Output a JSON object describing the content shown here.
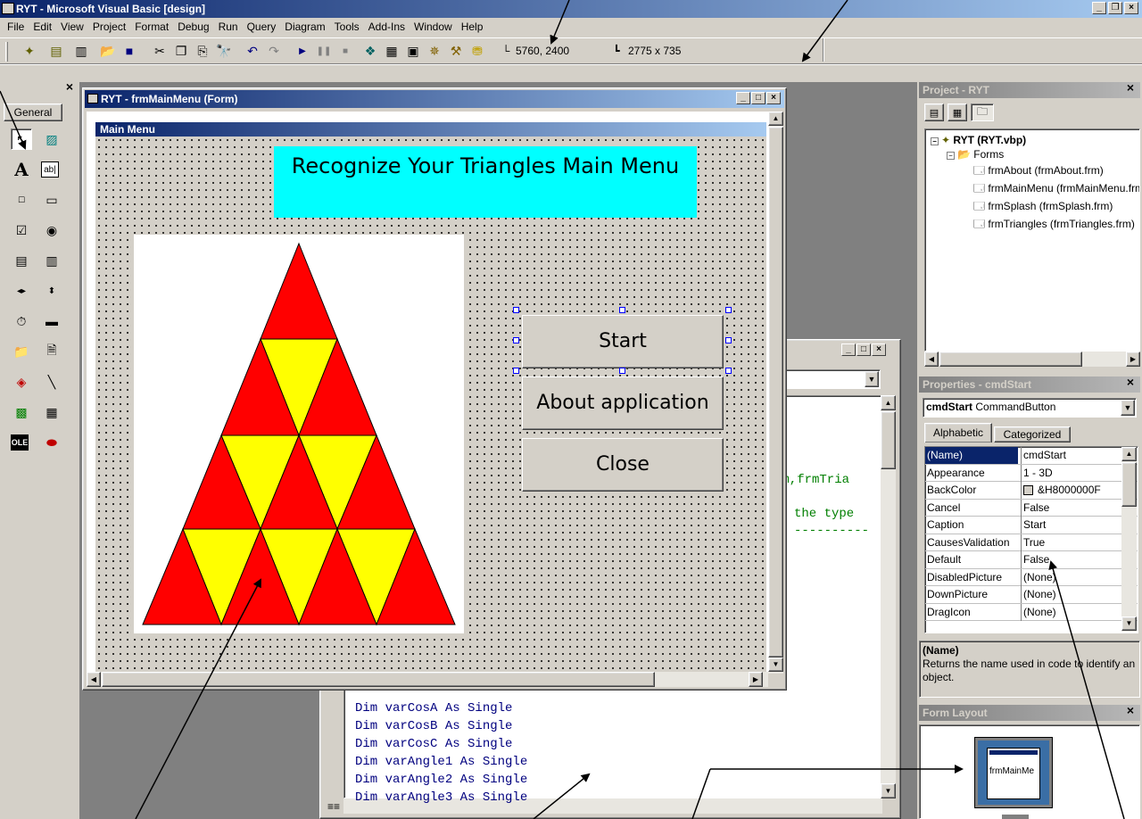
{
  "app": {
    "title": "RYT - Microsoft Visual Basic [design]"
  },
  "menubar": [
    "File",
    "Edit",
    "View",
    "Project",
    "Format",
    "Debug",
    "Run",
    "Query",
    "Diagram",
    "Tools",
    "Add-Ins",
    "Window",
    "Help"
  ],
  "toolbar": {
    "position_readout": "5760, 2400",
    "size_readout": "2775 x 735"
  },
  "toolbox": {
    "tab_label": "General"
  },
  "form_window": {
    "title": "RYT - frmMainMenu (Form)",
    "form_caption": "Main Menu",
    "heading": "Recognize Your Triangles Main Menu",
    "buttons": {
      "start": "Start",
      "about": "About application",
      "close": "Close"
    }
  },
  "code_window": {
    "partial_lines": [
      "rm,frmTria",
      "the type",
      "----------"
    ],
    "lines": [
      "Dim varCosA As Single",
      "Dim varCosB As Single",
      "Dim varCosC As Single",
      "Dim varAngle1 As Single",
      "Dim varAngle2 As Single",
      "Dim varAngle3 As Single"
    ]
  },
  "project": {
    "title": "Project - RYT",
    "root": "RYT (RYT.vbp)",
    "folder": "Forms",
    "forms": [
      "frmAbout (frmAbout.frm)",
      "frmMainMenu (frmMainMenu.frm)",
      "frmSplash (frmSplash.frm)",
      "frmTriangles (frmTriangles.frm)"
    ]
  },
  "properties": {
    "title": "Properties - cmdStart",
    "object_name": "cmdStart",
    "object_type": "CommandButton",
    "tabs": [
      "Alphabetic",
      "Categorized"
    ],
    "rows": [
      {
        "name": "(Name)",
        "value": "cmdStart"
      },
      {
        "name": "Appearance",
        "value": "1 - 3D"
      },
      {
        "name": "BackColor",
        "value": "&H8000000F"
      },
      {
        "name": "Cancel",
        "value": "False"
      },
      {
        "name": "Caption",
        "value": "Start"
      },
      {
        "name": "CausesValidation",
        "value": "True"
      },
      {
        "name": "Default",
        "value": "False"
      },
      {
        "name": "DisabledPicture",
        "value": "(None)"
      },
      {
        "name": "DownPicture",
        "value": "(None)"
      },
      {
        "name": "DragIcon",
        "value": "(None)"
      }
    ],
    "desc_title": "(Name)",
    "desc_text": "Returns the name used in code to identify an object."
  },
  "form_layout": {
    "title": "Form Layout",
    "preview_label": "frmMainMe"
  },
  "colors": {
    "title_active": "#0a246a",
    "title_gradient_end": "#a6caf0",
    "chrome": "#d4d0c8",
    "workspace": "#808080",
    "heading_bg": "#00ffff",
    "triangle_red": "#ff0000",
    "triangle_yellow": "#ffff00"
  }
}
